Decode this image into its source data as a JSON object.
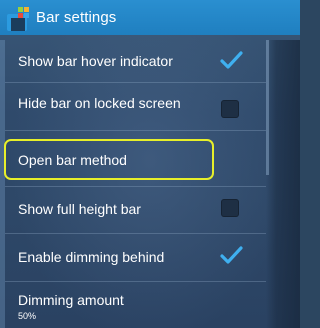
{
  "app": {
    "title": "Bar settings",
    "icon": "app-grid-icon"
  },
  "settings": [
    {
      "label": "Show bar hover indicator",
      "type": "checkbox",
      "checked": true
    },
    {
      "label": "Hide bar on locked screen",
      "type": "checkbox",
      "checked": false
    },
    {
      "label": "Open bar method",
      "type": "action"
    },
    {
      "label": "Show full height bar",
      "type": "checkbox",
      "checked": false
    },
    {
      "label": "Enable dimming behind",
      "type": "checkbox",
      "checked": true
    },
    {
      "label": "Dimming amount",
      "value": "50%",
      "type": "slider-pref",
      "level": 0.5
    }
  ],
  "colors": {
    "titlebar": "#2287c8",
    "checkmark": "#3fb0f0",
    "highlight": "#e7ef2a"
  }
}
